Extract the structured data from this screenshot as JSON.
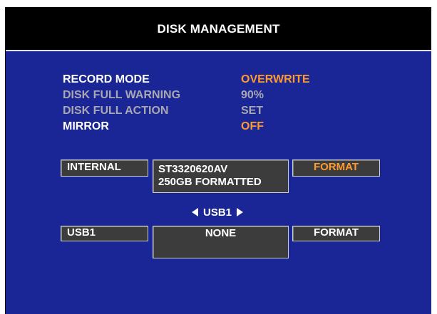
{
  "header": {
    "title": "DISK MANAGEMENT"
  },
  "settings": [
    {
      "label": "RECORD MODE",
      "value": "OVERWRITE",
      "label_color": "#ffffff",
      "value_color": "#ff9b2e"
    },
    {
      "label": "DISK FULL WARNING",
      "value": "90%",
      "label_color": "#a8a8b0",
      "value_color": "#a8a8b0"
    },
    {
      "label": "DISK FULL ACTION",
      "value": "SET",
      "label_color": "#a8a8b0",
      "value_color": "#a8a8b0"
    },
    {
      "label": "MIRROR",
      "value": "OFF",
      "label_color": "#ffffff",
      "value_color": "#ff9b2e"
    }
  ],
  "internal_disk": {
    "label": "INTERNAL",
    "model": "ST3320620AV",
    "status": "250GB FORMATTED",
    "format_label": "FORMAT"
  },
  "usb_selector": {
    "label": "USB1"
  },
  "usb_disk": {
    "label": "USB1",
    "status": "NONE",
    "format_label": "FORMAT"
  },
  "colors": {
    "background": "#1a2596",
    "title_bar": "#000000",
    "highlight": "#ff9b2e",
    "disabled": "#a8a8b0"
  }
}
